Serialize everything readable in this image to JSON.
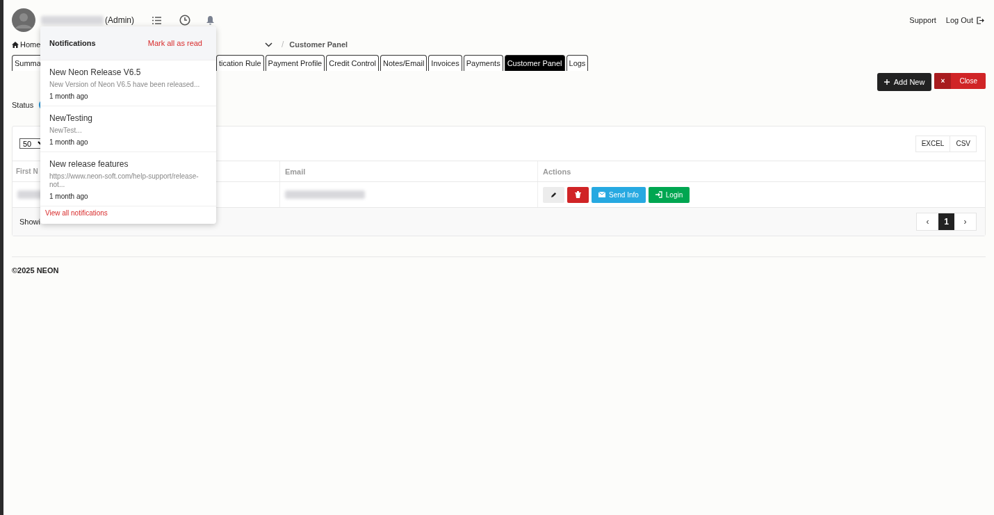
{
  "header": {
    "role": "(Admin)",
    "links": [
      "Support",
      "Log Out"
    ]
  },
  "breadcrumb": {
    "home": "Home",
    "separator": "/",
    "current": "Customer Panel"
  },
  "tabs": [
    {
      "label": "Summa",
      "selected": false
    },
    {
      "label": "tication Rule",
      "selected": false
    },
    {
      "label": "Payment Profile",
      "selected": false
    },
    {
      "label": "Credit Control",
      "selected": false
    },
    {
      "label": "Notes/Email",
      "selected": false
    },
    {
      "label": "Invoices",
      "selected": false
    },
    {
      "label": "Payments",
      "selected": false
    },
    {
      "label": "Customer Panel",
      "selected": true
    },
    {
      "label": "Logs",
      "selected": false
    }
  ],
  "toolbar": {
    "add": "Add New",
    "close_icon": "×",
    "close": "Close"
  },
  "status": {
    "label": "Status",
    "on": true
  },
  "table": {
    "page_size": "50",
    "exports": [
      "EXCEL",
      "CSV"
    ],
    "columns": [
      "First N",
      "Email",
      "Actions"
    ],
    "row_actions": [
      {
        "kind": "edit"
      },
      {
        "kind": "delete"
      },
      {
        "kind": "send",
        "label": "Send Info"
      },
      {
        "kind": "login",
        "label": "Login"
      }
    ],
    "showing": "Showi",
    "pagination": {
      "prev": "‹",
      "pages": [
        {
          "label": "1",
          "selected": true
        }
      ],
      "next": "›"
    }
  },
  "footer": "©2025 NEON",
  "notifications": {
    "title": "Notifications",
    "mark_all": "Mark all as read",
    "items": [
      {
        "title": "New Neon Release V6.5",
        "body": "New Version of Neon V6.5 have been released...",
        "time": "1 month ago"
      },
      {
        "title": "NewTesting",
        "body": "NewTest...",
        "time": "1 month ago"
      },
      {
        "title": "New release features",
        "body": "https://www.neon-soft.com/help-support/release-not...",
        "time": "1 month ago"
      }
    ],
    "view_all": "View all notifications"
  }
}
